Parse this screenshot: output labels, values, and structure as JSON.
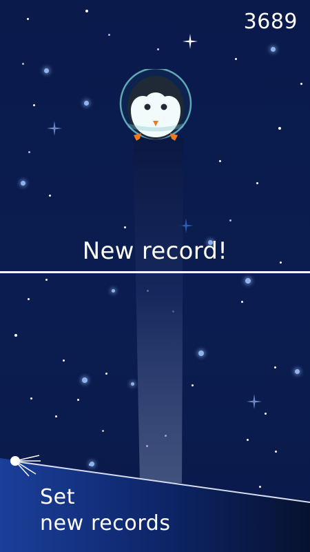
{
  "game": {
    "score": "3689",
    "record_message": "New record!",
    "promo_line1": "Set",
    "promo_line2": "new records"
  },
  "colors": {
    "sky": "#0b1a4a",
    "text": "#ffffff",
    "penguin_body": "#1f2a36",
    "penguin_belly": "#f1fbfc",
    "beak_and_feet": "#f07a22",
    "helmet": "#5fa8b4",
    "banner_left": "#1b3f9a",
    "banner_right": "#07122f"
  },
  "icons": {
    "player": "penguin-astronaut-icon",
    "satellite": "sputnik-satellite-icon",
    "sparkle": "four-point-star-icon"
  }
}
